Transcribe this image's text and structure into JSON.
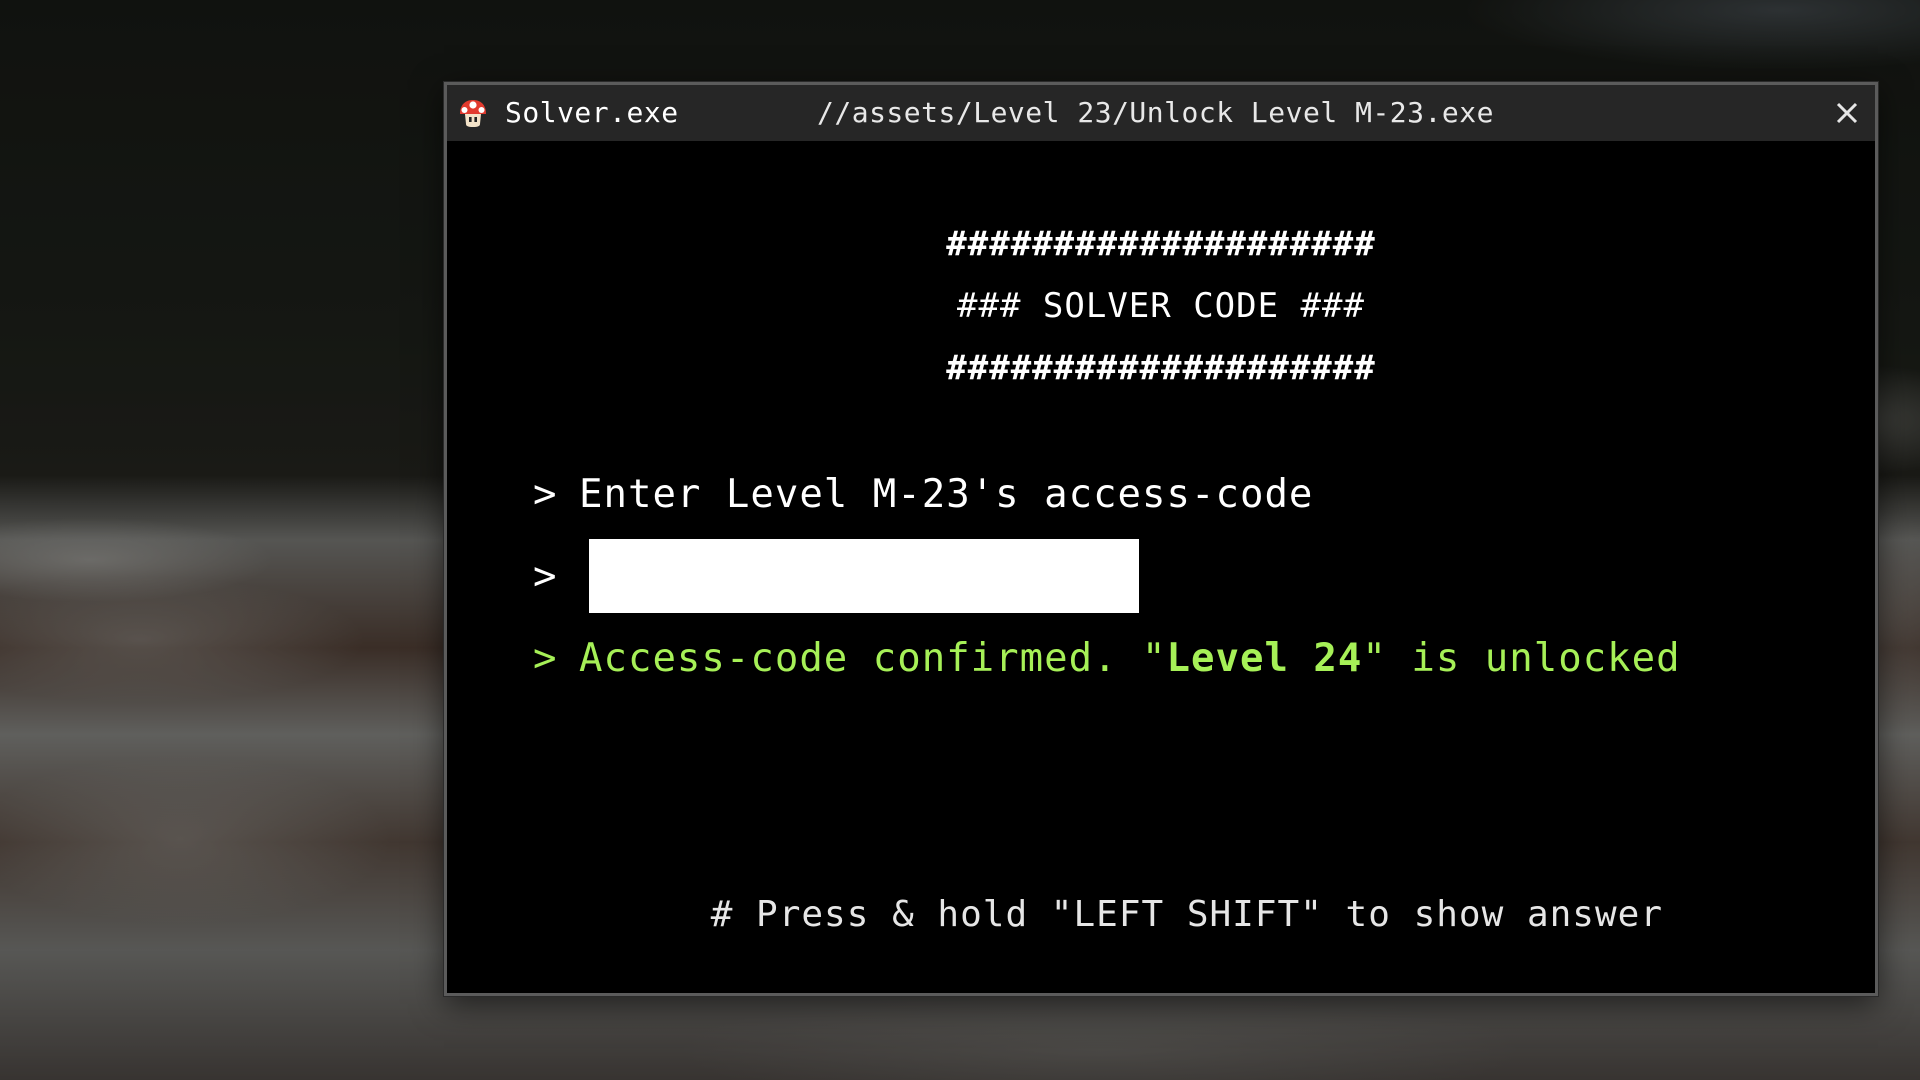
{
  "window": {
    "app_name": "Solver.exe",
    "path": "//assets/Level 23/Unlock Level M-23.exe",
    "icon": "mushroom-icon",
    "close_icon": "close-icon"
  },
  "banner": {
    "line1": "####################",
    "line2": "### SOLVER CODE ###",
    "line3": "####################"
  },
  "terminal": {
    "prompt_symbol": ">",
    "instruction": "Enter Level M-23's access-code",
    "input_value": "",
    "confirm_prefix": "Access-code confirmed. \"",
    "confirm_level": "Level 24",
    "confirm_suffix": "\" is unlocked",
    "hint": "# Press & hold \"LEFT SHIFT\" to show answer"
  },
  "colors": {
    "terminal_bg": "#000000",
    "titlebar_bg": "#262626",
    "success_green": "#a6f057",
    "text_white": "#ffffff"
  }
}
